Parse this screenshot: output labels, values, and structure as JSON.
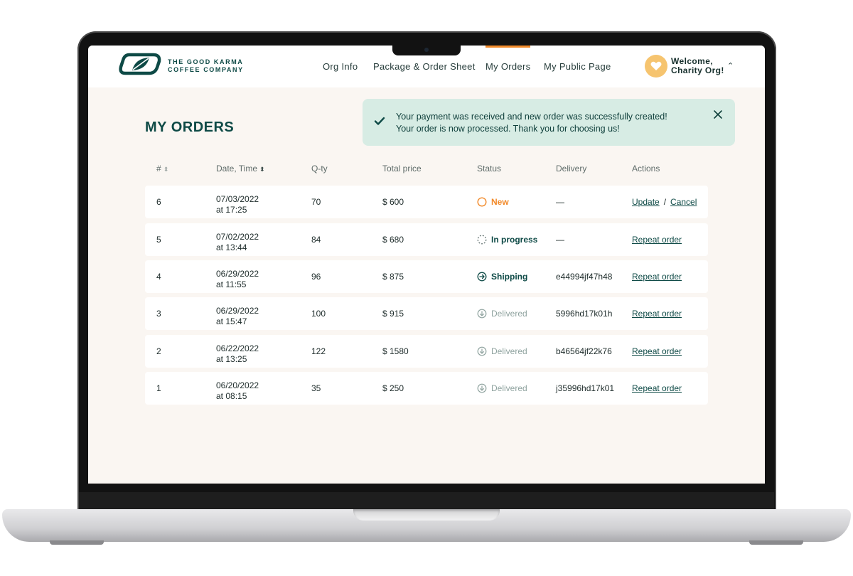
{
  "brand": {
    "line1": "THE GOOD KARMA",
    "line2": "COFFEE COMPANY"
  },
  "nav": [
    {
      "label": "Org Info",
      "active": false
    },
    {
      "label": "Package & Order Sheet",
      "active": false
    },
    {
      "label": "My Orders",
      "active": true
    },
    {
      "label": "My Public Page",
      "active": false
    }
  ],
  "user": {
    "greeting_line1": "Welcome,",
    "greeting_line2": "Charity Org!"
  },
  "page": {
    "title": "MY ORDERS"
  },
  "toast": {
    "line1": "Your payment was received and new order was successfully created!",
    "line2": "Your order is now processed. Thank you for choosing us!"
  },
  "table": {
    "headers": {
      "num": "#",
      "date": "Date, Time",
      "qty": "Q-ty",
      "total": "Total price",
      "status": "Status",
      "delivery": "Delivery",
      "actions": "Actions"
    },
    "rows": [
      {
        "num": "6",
        "date": "07/03/2022",
        "time": "at 17:25",
        "qty": "70",
        "total": "$ 600",
        "status": "New",
        "delivery": "—",
        "action1": "Update",
        "action2": "Cancel"
      },
      {
        "num": "5",
        "date": "07/02/2022",
        "time": "at 13:44",
        "qty": "84",
        "total": "$ 680",
        "status": "In progress",
        "delivery": "—",
        "action1": "Repeat order"
      },
      {
        "num": "4",
        "date": "06/29/2022",
        "time": "at 11:55",
        "qty": "96",
        "total": "$ 875",
        "status": "Shipping",
        "delivery": "e44994jf47h48",
        "action1": "Repeat order"
      },
      {
        "num": "3",
        "date": "06/29/2022",
        "time": "at 15:47",
        "qty": "100",
        "total": "$ 915",
        "status": "Delivered",
        "delivery": "5996hd17k01h",
        "action1": "Repeat order"
      },
      {
        "num": "2",
        "date": "06/22/2022",
        "time": "at 13:25",
        "qty": "122",
        "total": "$ 1580",
        "status": "Delivered",
        "delivery": "b46564jf22k76",
        "action1": "Repeat order"
      },
      {
        "num": "1",
        "date": "06/20/2022",
        "time": "at 08:15",
        "qty": "35",
        "total": "$ 250",
        "status": "Delivered",
        "delivery": "j35996hd17k01",
        "action1": "Repeat order"
      }
    ]
  },
  "colors": {
    "brand": "#0e4a46",
    "accent": "#f28a2a",
    "toast_bg": "#d7ece4",
    "page_bg": "#faf6f2"
  }
}
